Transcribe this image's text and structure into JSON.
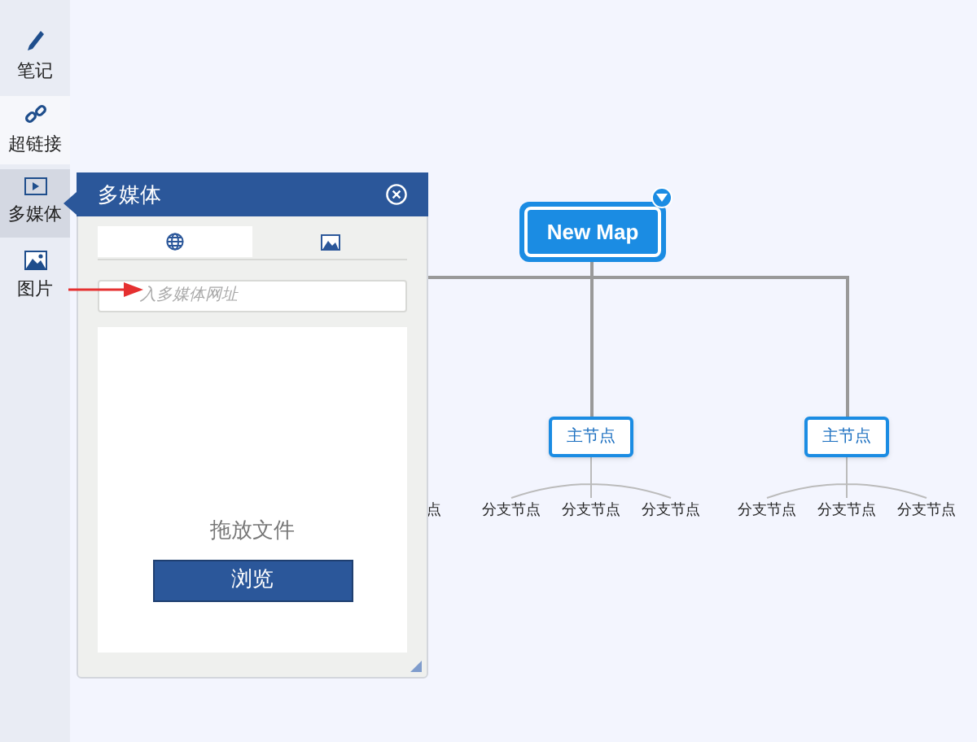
{
  "sidebar": {
    "items": [
      {
        "label": "笔记",
        "selected": false
      },
      {
        "label": "超链接",
        "selected": false
      },
      {
        "label": "多媒体",
        "selected": true
      },
      {
        "label": "图片",
        "selected": false
      }
    ]
  },
  "panel": {
    "title": "多媒体",
    "tabs": [
      {
        "selected": true
      },
      {
        "selected": false
      }
    ],
    "url_field": {
      "placeholder": "入多媒体网址"
    },
    "drop_area": {
      "hint": "拖放文件",
      "button": "浏览"
    }
  },
  "mind_map": {
    "root": "New Map",
    "clipped_label": "点",
    "main_nodes": [
      {
        "label": "主节点",
        "branches": [
          "分支节点",
          "分支节点",
          "分支节点"
        ]
      },
      {
        "label": "主节点",
        "branches": [
          "分支节点",
          "分支节点",
          "分支节点"
        ]
      }
    ]
  }
}
